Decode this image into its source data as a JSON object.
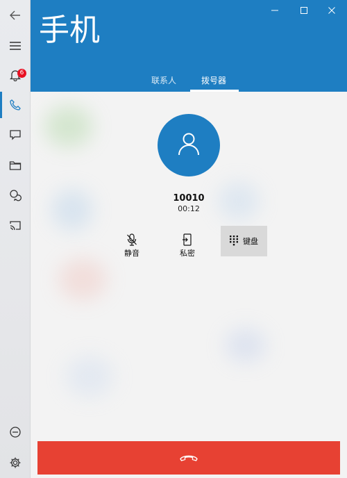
{
  "app": {
    "title": "手机"
  },
  "window_controls": {
    "minimize_icon": "minimize-icon",
    "maximize_icon": "maximize-icon",
    "close_icon": "close-icon"
  },
  "rail": {
    "back_icon": "back-arrow-icon",
    "menu_icon": "hamburger-menu-icon",
    "notifications_badge": "6",
    "items": [
      {
        "icon": "bell-icon"
      },
      {
        "icon": "phone-icon",
        "active": true
      },
      {
        "icon": "message-icon"
      },
      {
        "icon": "folder-icon"
      },
      {
        "icon": "chat-icon"
      },
      {
        "icon": "cast-screen-icon"
      }
    ],
    "bottom_items": [
      {
        "icon": "minus-circle-icon"
      },
      {
        "icon": "gear-icon"
      }
    ]
  },
  "tabs": [
    {
      "label": "联系人",
      "active": false
    },
    {
      "label": "拨号器",
      "active": true
    }
  ],
  "call": {
    "avatar_icon": "person-icon",
    "number": "10010",
    "duration": "00:12",
    "actions": {
      "mute": {
        "label": "静音",
        "icon": "mic-off-icon"
      },
      "privacy": {
        "label": "私密",
        "icon": "phone-transfer-icon"
      },
      "keypad": {
        "label": "键盘",
        "icon": "dialpad-icon"
      }
    },
    "hangup_icon": "hang-up-icon"
  },
  "colors": {
    "accent": "#1e7ec2",
    "hangup": "#e74133",
    "badge": "#e81123"
  }
}
